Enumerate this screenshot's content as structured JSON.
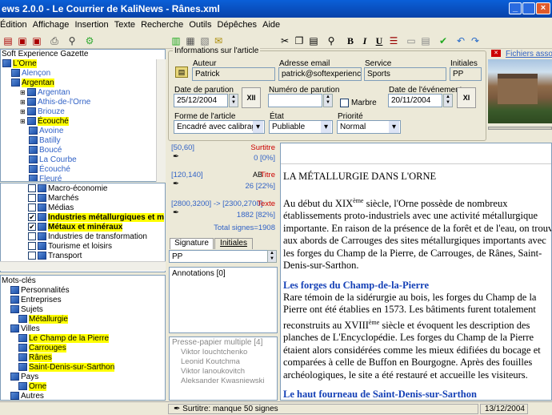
{
  "window": {
    "title": "ews 2.0.0 - Le Courrier de KaliNews - Rânes.xml"
  },
  "menu": [
    "Édition",
    "Affichage",
    "Insertion",
    "Texte",
    "Recherche",
    "Outils",
    "Dépêches",
    "Aide"
  ],
  "left": {
    "header": "Soft Experience Gazette",
    "tree": [
      {
        "label": "L'Orne",
        "indent": 0,
        "style": "hl"
      },
      {
        "label": "Alençon",
        "indent": 1,
        "style": "blue"
      },
      {
        "label": "Argentan",
        "indent": 1,
        "style": "hl"
      },
      {
        "label": "Argentan",
        "indent": 2,
        "style": "blue"
      },
      {
        "label": "Athis-de-l'Orne",
        "indent": 2,
        "style": "blue"
      },
      {
        "label": "Briouze",
        "indent": 2,
        "style": "blue"
      },
      {
        "label": "Écouché",
        "indent": 2,
        "style": "hl"
      },
      {
        "label": "Avoine",
        "indent": 3,
        "style": "blue"
      },
      {
        "label": "Batilly",
        "indent": 3,
        "style": "blue"
      },
      {
        "label": "Boucé",
        "indent": 3,
        "style": "blue"
      },
      {
        "label": "La Courbe",
        "indent": 3,
        "style": "blue"
      },
      {
        "label": "Écouché",
        "indent": 3,
        "style": "blue"
      },
      {
        "label": "Fleuré",
        "indent": 3,
        "style": "blue"
      }
    ],
    "categories": [
      {
        "label": "Macro-économie",
        "checked": false,
        "style": ""
      },
      {
        "label": "Marchés",
        "checked": false,
        "style": ""
      },
      {
        "label": "Médias",
        "checked": false,
        "style": ""
      },
      {
        "label": "Industries métallurgiques et m",
        "checked": true,
        "style": "hl"
      },
      {
        "label": "Métaux et minéraux",
        "checked": true,
        "style": "hl"
      },
      {
        "label": "Industries de transformation",
        "checked": false,
        "style": ""
      },
      {
        "label": "Tourisme et loisirs",
        "checked": false,
        "style": ""
      },
      {
        "label": "Transport",
        "checked": false,
        "style": ""
      }
    ],
    "keywords_header": "Mots-clés",
    "keywords": [
      {
        "label": "Personnalités",
        "indent": 1,
        "style": ""
      },
      {
        "label": "Entreprises",
        "indent": 1,
        "style": ""
      },
      {
        "label": "Sujets",
        "indent": 1,
        "style": ""
      },
      {
        "label": "Métallurgie",
        "indent": 2,
        "style": "hl"
      },
      {
        "label": "Villes",
        "indent": 1,
        "style": ""
      },
      {
        "label": "Le Champ de la Pierre",
        "indent": 2,
        "style": "hl"
      },
      {
        "label": "Carrouges",
        "indent": 2,
        "style": "hl"
      },
      {
        "label": "Rânes",
        "indent": 2,
        "style": "hl"
      },
      {
        "label": "Saint-Denis-sur-Sarthon",
        "indent": 2,
        "style": "hl"
      },
      {
        "label": "Pays",
        "indent": 1,
        "style": ""
      },
      {
        "label": "Orne",
        "indent": 2,
        "style": "hl"
      },
      {
        "label": "Autres",
        "indent": 1,
        "style": ""
      }
    ]
  },
  "info": {
    "group": "Informations sur l'article",
    "auteur_label": "Auteur",
    "auteur": "Patrick",
    "email_label": "Adresse email",
    "email": "patrick@softexperience.co",
    "service_label": "Service",
    "service": "Sports",
    "initiales_label": "Initiales",
    "initiales": "PP",
    "date_parution_label": "Date de parution",
    "date_parution": "25/12/2004",
    "numero_label": "Numéro de parution",
    "numero": "",
    "marbre_label": "Marbre",
    "date_event_label": "Date de l'événement",
    "date_event": "20/11/2004",
    "forme_label": "Forme de l'article",
    "forme": "Encadré avec calibrage",
    "etat_label": "État",
    "etat": "Publiable",
    "priorite_label": "Priorité",
    "priorite": "Normal",
    "btn_xii": "XII",
    "btn_xi": "XI",
    "files_link": "Fichiers assoc"
  },
  "stats": {
    "surtitre_range": "[50,60]",
    "surtitre_label": "Surtitre",
    "surtitre_value": "0 [0%]",
    "titre_range": "[120,140]",
    "titre_label": "Titre",
    "titre_value": "26 [22%]",
    "texte_range": "[2800,3200] -> [2300,2700]",
    "texte_label": "Texte",
    "texte_value": "1882 [82%]",
    "total": "Total signes=1908"
  },
  "tabs": {
    "signature": "Signature",
    "initiales": "Initiales",
    "value": "PP"
  },
  "annotations": "Annotations [0]",
  "clipboard": {
    "header": "Presse-papier multiple [4]",
    "items": [
      "Viktor Iouchtchenko",
      "Leonid Koutchma",
      "Viktor Ianoukovitch",
      "Aleksander Kwasniewski"
    ]
  },
  "doc": {
    "title": "LA MÉTALLURGIE DANS L'ORNE",
    "p1a": "Au début du XIX",
    "p1sup": "ème",
    "p1b": " siècle, l'Orne possède de nombreux établissements proto-industriels avec une activité métallurgique importante. En raison de la présence de la forêt et de l'eau, on trouve aux abords de Carrouges des sites métallurgiques importants avec les forges du Champ de la Pierre, de Carrouges, de Rânes, Saint-Denis-sur-Sarthon.",
    "h2": "Les forges du Champ-de-la-Pierre",
    "p2a": "Rare témoin de la sidérurgie au bois, les forges du Champ de la Pierre ont été établies en 1573. Les bâtiments furent totalement reconstruits au XVIII",
    "p2sup": "ème",
    "p2b": " siècle et évoquent les description des planches de L'Encyclopédie. Les forges du Champ de la Pierre étaient alors considérées comme les mieux édifiées du bocage et comparées à celle de Buffon en Bourgogne. Après des fouilles archéologiques, le site a été restauré et accueille les visiteurs.",
    "h3": "Le haut fourneau de Saint-Denis-sur-Sarthon"
  },
  "status": {
    "message": "Surtitre: manque 50 signes",
    "date": "13/12/2004"
  }
}
